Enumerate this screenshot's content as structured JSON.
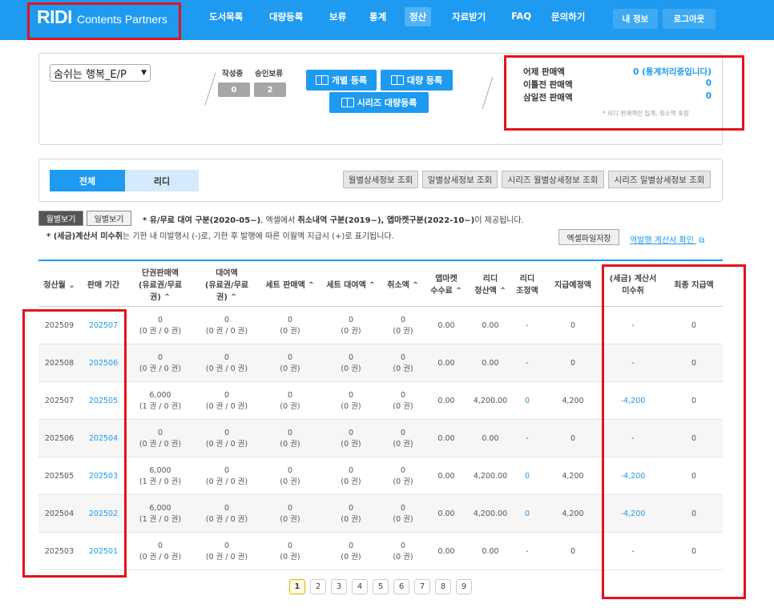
{
  "header": {
    "brand": "RIDI",
    "brand_sub": "Contents Partners",
    "nav": [
      "도서목록",
      "대량등록",
      "보류",
      "통계",
      "정산",
      "자료받기",
      "FAQ",
      "문의하기"
    ],
    "my_info": "내 정보",
    "logout": "로그아웃"
  },
  "summary": {
    "book_select": "숨쉬는 행복_E/P",
    "writing_label": "작성중",
    "approval_label": "승인보류",
    "writing_count": "0",
    "approval_count": "2",
    "btn_single": "개별 등록",
    "btn_bulk": "대량 등록",
    "btn_series": "시리즈 대량등록",
    "yesterday_label": "어제 판매액",
    "yesterday_value": "0 (통계처리중입니다)",
    "two_days_label": "이틀전 판매액",
    "two_days_value": "0",
    "three_days_label": "삼일전 판매액",
    "three_days_value": "0",
    "note": "* 리디 판매액만 집계, 취소액 포함"
  },
  "tabs": {
    "all": "전체",
    "ridi": "리디",
    "q1": "월별상세정보 조회",
    "q2": "일별상세정보 조회",
    "q3": "시리즈 월별상세정보 조회",
    "q4": "시리즈 일별상세정보 조회"
  },
  "view": {
    "monthly": "월별보기",
    "daily": "일별보기",
    "note1_a": "* 유/무료 대여 구분(2020-05~)",
    "note1_b": ", 엑셀에서 ",
    "note1_c": "취소내역 구분(2019~), 앱마켓구분(2022-10~)",
    "note1_d": "이 제공됩니다.",
    "note2_a": "* (세금)계산서 미수취",
    "note2_b": "는 기한 내 미발행시 (-)로, 기한 후 발행에 따른 이월액 지급시 (+)로 표기됩니다.",
    "excel": "엑셀파일저장",
    "invoice_link": "역발행 계산서 확인"
  },
  "table": {
    "headers": [
      "정산월 ⌄",
      "판매 기간",
      "단권판매액\n(유료권/무료\n권) ⌃",
      "대여액\n(유료권/무료\n권) ⌃",
      "세트 판매액 ⌃",
      "세트 대여액 ⌃",
      "취소액 ⌃",
      "앱마켓\n수수료 ⌃",
      "리디\n정산액 ⌃",
      "리디\n조정액",
      "지급예정액",
      "(세금) 계산서\n미수취",
      "최종 지급액"
    ],
    "rows": [
      {
        "month": "202509",
        "period": "202507",
        "single": "0",
        "single_sub": "(0 권 / 0 권)",
        "rent": "0",
        "rent_sub": "(0 권 / 0 권)",
        "set": "0",
        "set_sub": "(0 권)",
        "setrent": "0",
        "setrent_sub": "(0 권)",
        "cancel": "0",
        "cancel_sub": "(0 권)",
        "fee": "0.00",
        "settle": "0.00",
        "adjust": "-",
        "pay": "0",
        "invoice": "-",
        "final": "0"
      },
      {
        "month": "202508",
        "period": "202506",
        "single": "0",
        "single_sub": "(0 권 / 0 권)",
        "rent": "0",
        "rent_sub": "(0 권 / 0 권)",
        "set": "0",
        "set_sub": "(0 권)",
        "setrent": "0",
        "setrent_sub": "(0 권)",
        "cancel": "0",
        "cancel_sub": "(0 권)",
        "fee": "0.00",
        "settle": "0.00",
        "adjust": "-",
        "pay": "0",
        "invoice": "-",
        "final": "0"
      },
      {
        "month": "202507",
        "period": "202505",
        "single": "6,000",
        "single_sub": "(1 권 / 0 권)",
        "rent": "0",
        "rent_sub": "(0 권 / 0 권)",
        "set": "0",
        "set_sub": "(0 권)",
        "setrent": "0",
        "setrent_sub": "(0 권)",
        "cancel": "0",
        "cancel_sub": "(0 권)",
        "fee": "0.00",
        "settle": "4,200.00",
        "adjust": "0",
        "pay": "4,200",
        "invoice": "-4,200",
        "final": "0"
      },
      {
        "month": "202506",
        "period": "202504",
        "single": "0",
        "single_sub": "(0 권 / 0 권)",
        "rent": "0",
        "rent_sub": "(0 권 / 0 권)",
        "set": "0",
        "set_sub": "(0 권)",
        "setrent": "0",
        "setrent_sub": "(0 권)",
        "cancel": "0",
        "cancel_sub": "(0 권)",
        "fee": "0.00",
        "settle": "0.00",
        "adjust": "-",
        "pay": "0",
        "invoice": "-",
        "final": "0"
      },
      {
        "month": "202505",
        "period": "202503",
        "single": "6,000",
        "single_sub": "(1 권 / 0 권)",
        "rent": "0",
        "rent_sub": "(0 권 / 0 권)",
        "set": "0",
        "set_sub": "(0 권)",
        "setrent": "0",
        "setrent_sub": "(0 권)",
        "cancel": "0",
        "cancel_sub": "(0 권)",
        "fee": "0.00",
        "settle": "4,200.00",
        "adjust": "0",
        "pay": "4,200",
        "invoice": "-4,200",
        "final": "0"
      },
      {
        "month": "202504",
        "period": "202502",
        "single": "6,000",
        "single_sub": "(1 권 / 0 권)",
        "rent": "0",
        "rent_sub": "(0 권 / 0 권)",
        "set": "0",
        "set_sub": "(0 권)",
        "setrent": "0",
        "setrent_sub": "(0 권)",
        "cancel": "0",
        "cancel_sub": "(0 권)",
        "fee": "0.00",
        "settle": "4,200.00",
        "adjust": "0",
        "pay": "4,200",
        "invoice": "-4,200",
        "final": "0"
      },
      {
        "month": "202503",
        "period": "202501",
        "single": "0",
        "single_sub": "(0 권 / 0 권)",
        "rent": "0",
        "rent_sub": "(0 권 / 0 권)",
        "set": "0",
        "set_sub": "(0 권)",
        "setrent": "0",
        "setrent_sub": "(0 권)",
        "cancel": "0",
        "cancel_sub": "(0 권)",
        "fee": "0.00",
        "settle": "0.00",
        "adjust": "-",
        "pay": "0",
        "invoice": "-",
        "final": "0"
      }
    ]
  },
  "pagination": [
    "1",
    "2",
    "3",
    "4",
    "5",
    "6",
    "7",
    "8",
    "9"
  ],
  "colors": {
    "primary": "#1e9af0",
    "highlight_box": "#e4121b",
    "tab_inactive": "#d3ebfc"
  }
}
